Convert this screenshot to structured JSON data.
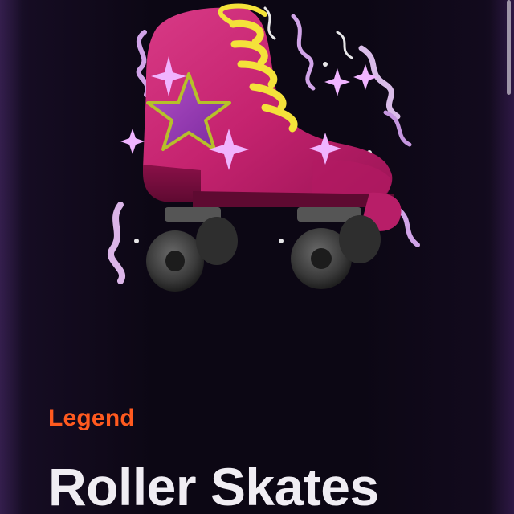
{
  "item": {
    "rarity": "Legend",
    "name": "Roller Skates",
    "image_subject": "pink roller skate with star decal and sparkle aura"
  },
  "colors": {
    "background": "#0c0714",
    "rarity_legend": "#ff5a1f",
    "title_text": "#f0edf3",
    "skate_boot": "#c5236f",
    "skate_laces": "#f4e23a",
    "aura": "#e7b6ff"
  }
}
